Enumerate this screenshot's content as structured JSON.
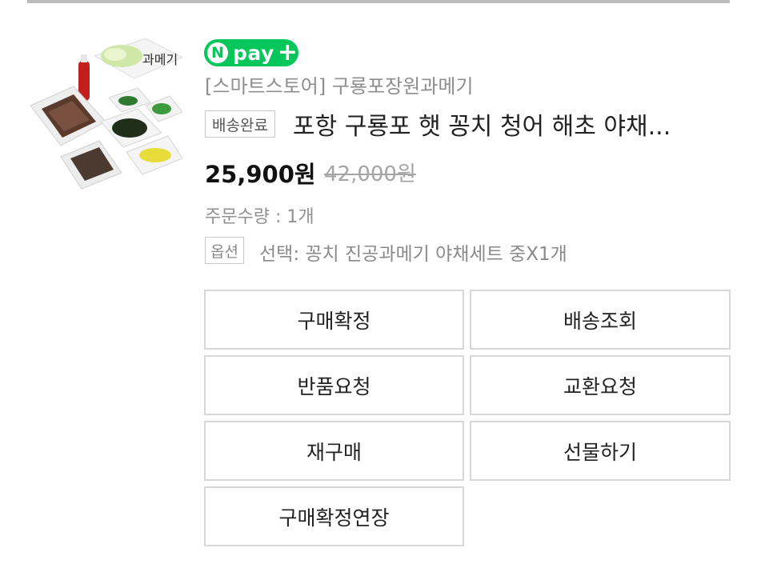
{
  "pay_badge": {
    "n": "N",
    "text": "pay",
    "plus": "+"
  },
  "order": {
    "store": "[스마트스토어] 구룡포장원과메기",
    "status": "배송완료",
    "title": "포항 구룡포 햇 꽁치 청어 해초 야채...",
    "price": "25,900원",
    "original_price": "42,000원",
    "quantity": "주문수량 : 1개",
    "option_tag": "옵션",
    "option_text": "선택: 꽁치 진공과메기 야채세트 중X1개"
  },
  "buttons": {
    "confirm": "구매확정",
    "tracking": "배송조회",
    "return": "반품요청",
    "exchange": "교환요청",
    "rebuy": "재구매",
    "gift": "선물하기",
    "extend": "구매확정연장"
  },
  "colors": {
    "npay_green": "#03c75a",
    "border": "#d7d7d7",
    "muted_text": "#8e8e8e"
  },
  "icons": {
    "thumbnail": "product-photo-gwamegi-set"
  }
}
